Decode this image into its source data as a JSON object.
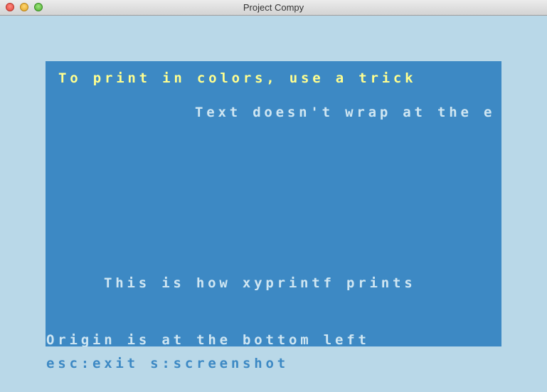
{
  "window": {
    "title": "Project Compy"
  },
  "screen": {
    "background_color": "#3d89c4",
    "lines": {
      "colored": "To print in colors, use a trick",
      "no_wrap": "Text doesn't wrap at the e",
      "xyprintf": "This is how xyprintf prints",
      "origin": "Origin is at the bottom left"
    }
  },
  "footer": {
    "hint": "esc:exit s:screenshot"
  }
}
